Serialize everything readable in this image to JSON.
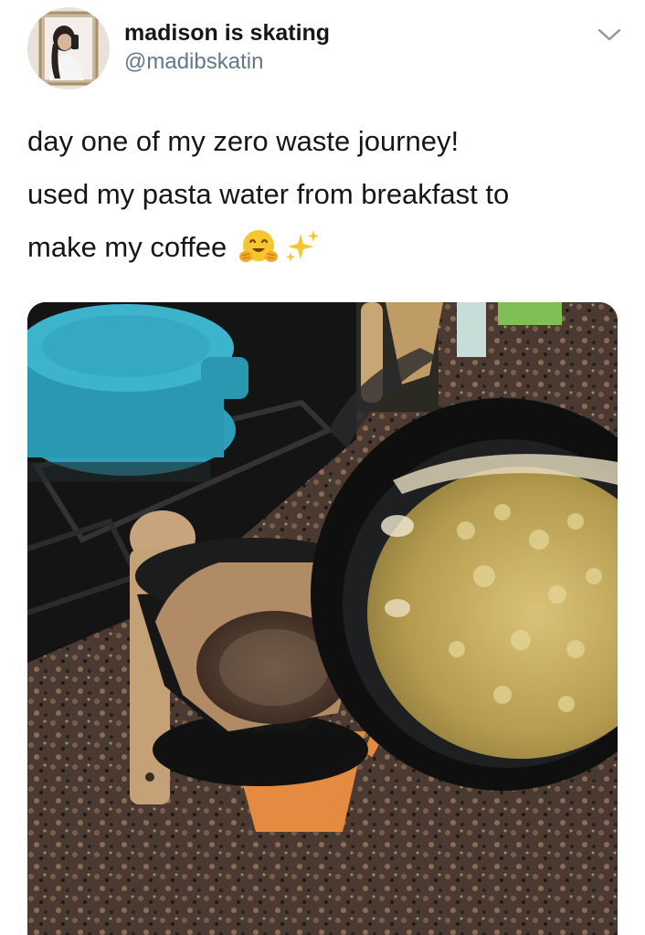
{
  "author": {
    "display_name": "madison is skating",
    "handle": "@madibskatin"
  },
  "tweet": {
    "lines": [
      "day one of my zero waste journey!",
      "used my pasta water from breakfast to",
      "make my coffee"
    ],
    "emojis": [
      "hugging-face-icon",
      "sparkles-icon"
    ]
  },
  "media": {
    "subject": "photo"
  },
  "icons": {
    "menu": "chevron-down-icon"
  },
  "colors": {
    "text": "#14171a",
    "secondary": "#657786",
    "chevron": "#8899a6"
  }
}
